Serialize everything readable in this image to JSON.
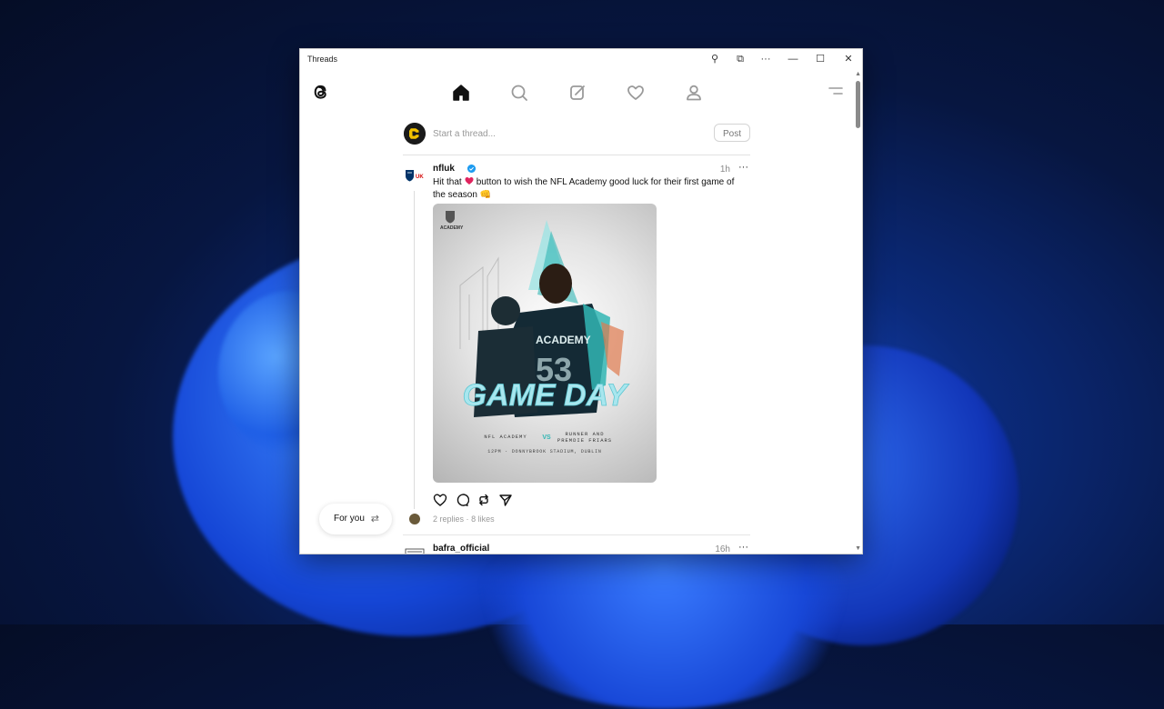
{
  "window": {
    "title": "Threads",
    "controls": {
      "pin": "⚲",
      "cast": "⧉",
      "more": "···",
      "minimize": "—",
      "maximize": "☐",
      "close": "✕"
    }
  },
  "nav": {
    "items": [
      "home-icon",
      "search-icon",
      "compose-icon",
      "heart-icon",
      "profile-icon"
    ],
    "active": "home-icon"
  },
  "composer": {
    "placeholder": "Start a thread...",
    "post_label": "Post"
  },
  "posts": [
    {
      "username": "nfluk",
      "verified": true,
      "time": "1h",
      "more": "···",
      "text_before": "Hit that",
      "text_after": "button to wish the NFL Academy good luck for their first game of the season 👊",
      "image": {
        "brand": "ACADEMY",
        "jersey": "ACADEMY",
        "number": "53",
        "headline": "GAME DAY",
        "team_left": "NFL ACADEMY",
        "vs": "VS",
        "team_right_line1": "RUNNER AND",
        "team_right_line2": "PREMDIE FRIARS",
        "venue": "12PM · DONNYBROOK STADIUM, DUBLIN"
      },
      "replies": "2 replies",
      "separator": "·",
      "likes": "8 likes"
    },
    {
      "username": "bafra_official",
      "time": "16h",
      "more": "···"
    }
  ],
  "feed_toggle": {
    "label": "For you",
    "icon": "⇄"
  },
  "colors": {
    "verified": "#1d9bf0",
    "heart": "#e0245e",
    "accent_teal": "#31b6b4"
  }
}
